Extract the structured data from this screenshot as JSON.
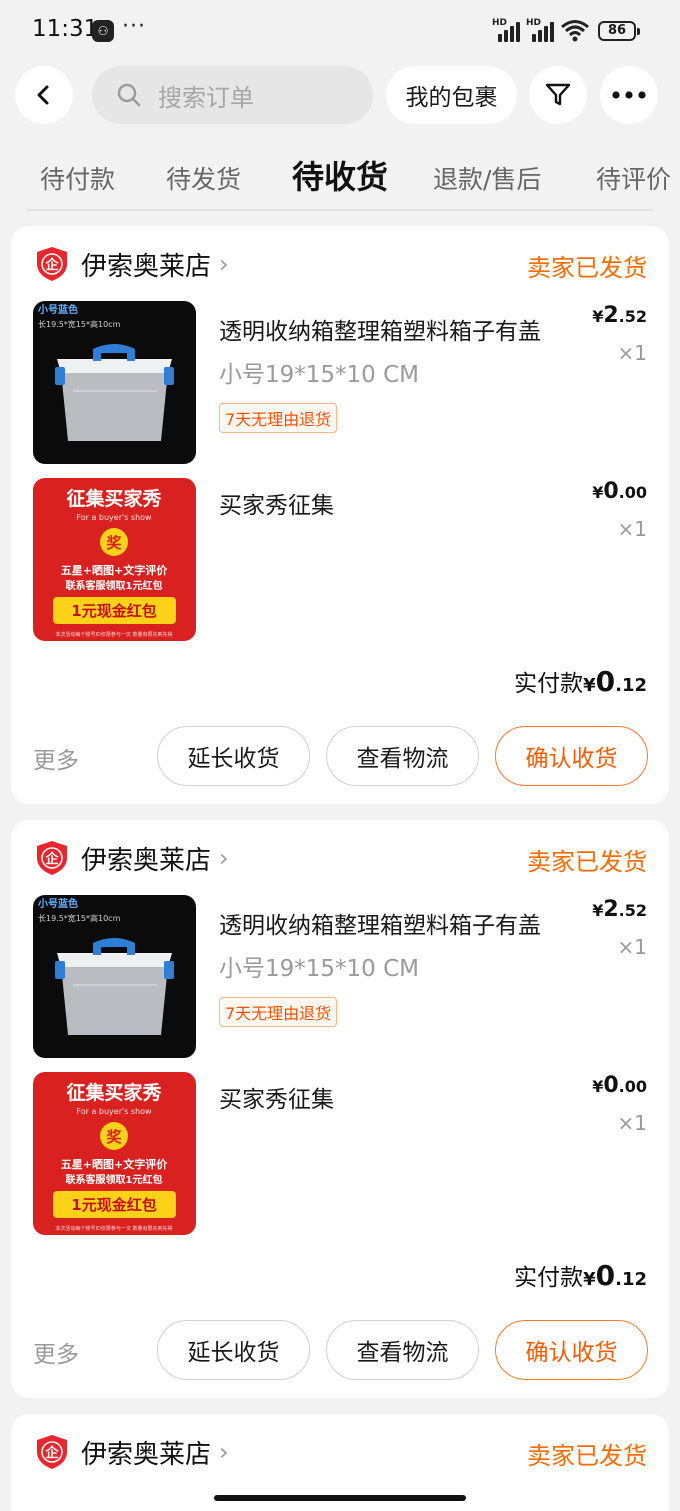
{
  "status_bar": {
    "time": "11:31",
    "battery": "86",
    "signal1": "HD",
    "signal2": "HD"
  },
  "header": {
    "search_placeholder": "搜索订单",
    "package_button": "我的包裹"
  },
  "tabs": [
    {
      "label": "待付款",
      "active": false
    },
    {
      "label": "待发货",
      "active": false
    },
    {
      "label": "待收货",
      "active": true
    },
    {
      "label": "退款/售后",
      "active": false
    },
    {
      "label": "待评价",
      "active": false
    }
  ],
  "orders": [
    {
      "shop_name": "伊索奥莱店",
      "shop_logo_text": "企",
      "status": "卖家已发货",
      "items": [
        {
          "title": "透明收纳箱整理箱塑料箱子有盖",
          "spec": "小号19*15*10 CM",
          "tag": "7天无理由退货",
          "price_symbol": "¥",
          "price_int": "2",
          "price_dec": ".52",
          "qty": "×1",
          "img_label": "小号蓝色",
          "img_dims": "长19.5*宽15*高10cm"
        },
        {
          "title": "买家秀征集",
          "spec": "",
          "tag": "",
          "price_symbol": "¥",
          "price_int": "0",
          "price_dec": ".00",
          "qty": "×1",
          "img_title": "征集买家秀",
          "img_sub": "For a buyer's show",
          "img_award": "奖",
          "img_line1": "五星+晒图+文字评价",
          "img_line2": "联系客服领取1元红包",
          "img_btn": "1元现金红包",
          "img_footer": "本次活动每个账号ID仅限参与一次 数量有限先到先得"
        }
      ],
      "paid_label": "实付款",
      "paid_symbol": "¥",
      "paid_int": "0",
      "paid_dec": ".12",
      "more": "更多",
      "btn_extend": "延长收货",
      "btn_logistics": "查看物流",
      "btn_confirm": "确认收货"
    },
    {
      "shop_name": "伊索奥莱店",
      "shop_logo_text": "企",
      "status": "卖家已发货",
      "items": [
        {
          "title": "透明收纳箱整理箱塑料箱子有盖",
          "spec": "小号19*15*10 CM",
          "tag": "7天无理由退货",
          "price_symbol": "¥",
          "price_int": "2",
          "price_dec": ".52",
          "qty": "×1",
          "img_label": "小号蓝色",
          "img_dims": "长19.5*宽15*高10cm"
        },
        {
          "title": "买家秀征集",
          "spec": "",
          "tag": "",
          "price_symbol": "¥",
          "price_int": "0",
          "price_dec": ".00",
          "qty": "×1",
          "img_title": "征集买家秀",
          "img_sub": "For a buyer's show",
          "img_award": "奖",
          "img_line1": "五星+晒图+文字评价",
          "img_line2": "联系客服领取1元红包",
          "img_btn": "1元现金红包",
          "img_footer": "本次活动每个账号ID仅限参与一次 数量有限先到先得"
        }
      ],
      "paid_label": "实付款",
      "paid_symbol": "¥",
      "paid_int": "0",
      "paid_dec": ".12",
      "more": "更多",
      "btn_extend": "延长收货",
      "btn_logistics": "查看物流",
      "btn_confirm": "确认收货"
    },
    {
      "shop_name": "伊索奥莱店",
      "shop_logo_text": "企",
      "status": "卖家已发货"
    }
  ],
  "colors": {
    "accent": "#ff6a00",
    "shop_logo": "#e8262d",
    "promo_red": "#d9211f",
    "promo_yellow": "#ffd21a"
  }
}
